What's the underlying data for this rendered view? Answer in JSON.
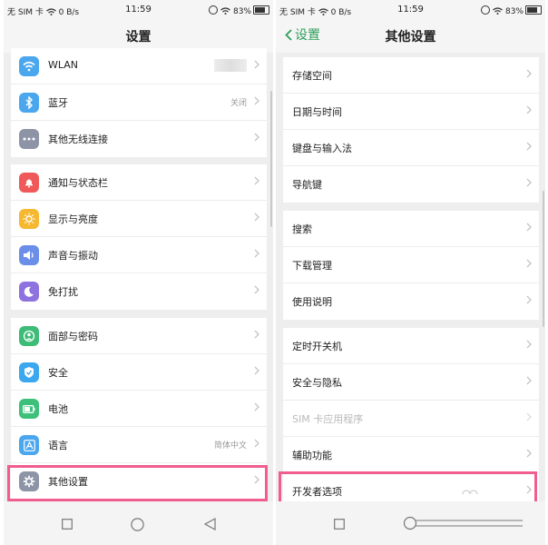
{
  "left": {
    "status": {
      "carrier": "无 SIM 卡",
      "net_speed": "0 B/s",
      "time": "11:59",
      "battery": "83%"
    },
    "header": {
      "title": "设置"
    },
    "groups": [
      {
        "items": [
          {
            "label": "WLAN",
            "icon": "wifi-icon",
            "color": "#4aa7ee"
          },
          {
            "label": "蓝牙",
            "value": "关闭",
            "icon": "bluetooth-icon",
            "color": "#4aa7ee"
          },
          {
            "label": "其他无线连接",
            "icon": "more-dots-icon",
            "color": "#8d94a6"
          }
        ]
      },
      {
        "items": [
          {
            "label": "通知与状态栏",
            "icon": "bell-icon",
            "color": "#f0595a"
          },
          {
            "label": "显示与亮度",
            "icon": "sun-icon",
            "color": "#f5b830"
          },
          {
            "label": "声音与振动",
            "icon": "speaker-icon",
            "color": "#6b8ee8"
          },
          {
            "label": "免打扰",
            "icon": "moon-icon",
            "color": "#8e72df"
          }
        ]
      },
      {
        "items": [
          {
            "label": "面部与密码",
            "icon": "face-icon",
            "color": "#3dbc78"
          },
          {
            "label": "安全",
            "icon": "shield-icon",
            "color": "#3aa7ee"
          },
          {
            "label": "电池",
            "icon": "battery-icon",
            "color": "#3cc07a"
          },
          {
            "label": "语言",
            "value": "简体中文",
            "icon": "language-icon",
            "color": "#4aa7ee"
          },
          {
            "label": "其他设置",
            "icon": "gear-icon",
            "color": "#8d94a6"
          }
        ]
      }
    ]
  },
  "right": {
    "status": {
      "carrier": "无 SIM 卡",
      "net_speed": "0 B/s",
      "time": "11:59",
      "battery": "83%"
    },
    "header": {
      "title": "其他设置",
      "back_label": "设置"
    },
    "groups": [
      {
        "items": [
          {
            "label": "存储空间"
          },
          {
            "label": "日期与时间"
          },
          {
            "label": "键盘与输入法"
          },
          {
            "label": "导航键"
          }
        ]
      },
      {
        "items": [
          {
            "label": "搜索"
          },
          {
            "label": "下载管理"
          },
          {
            "label": "使用说明"
          }
        ]
      },
      {
        "items": [
          {
            "label": "定时开关机"
          },
          {
            "label": "安全与隐私"
          },
          {
            "label": "SIM 卡应用程序",
            "disabled": true
          },
          {
            "label": "辅助功能"
          },
          {
            "label": "开发者选项"
          }
        ]
      }
    ]
  },
  "colors": {
    "accent_green": "#2e9e5b",
    "highlight_pink": "#f05d8e",
    "bg": "#eeeeef"
  }
}
